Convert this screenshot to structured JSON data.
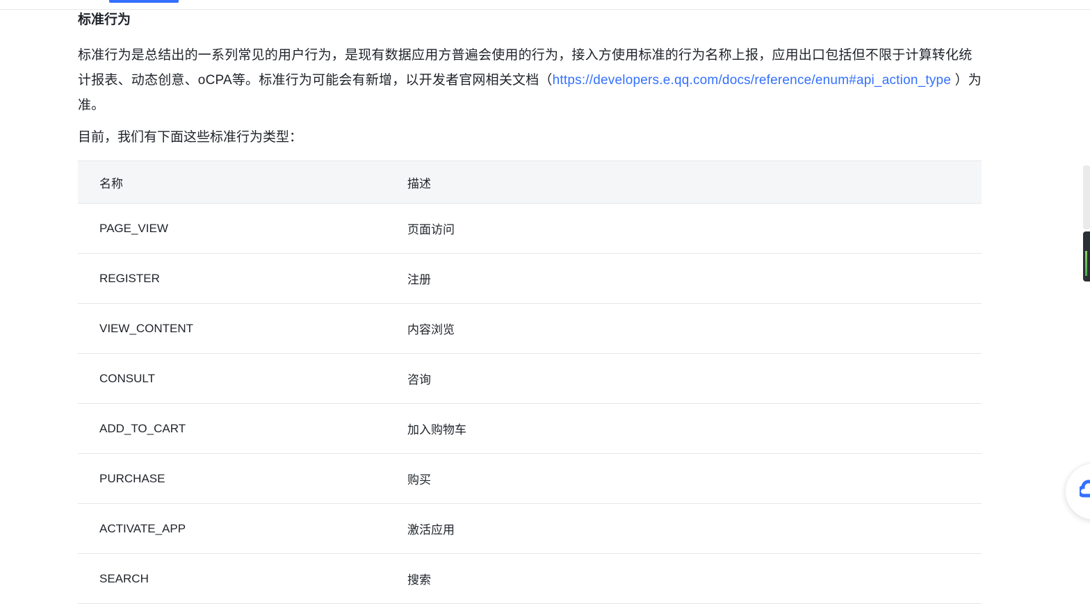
{
  "section": {
    "title": "标准行为",
    "intro_text": "标准行为是总结出的一系列常见的用户行为，是现有数据应用方普遍会使用的行为，接入方使用标准的行为名称上报，应用出口包括但不限于计算转化统计报表、动态创意、oCPA等。标准行为可能会有新增，以开发者官网相关文档（",
    "link_text": "https://developers.e.qq.com/docs/reference/enum#api_action_type",
    "intro_suffix": " ）为准。",
    "types_intro": "目前，我们有下面这些标准行为类型："
  },
  "table": {
    "headers": {
      "name": "名称",
      "description": "描述"
    },
    "rows": [
      {
        "name": "PAGE_VIEW",
        "description": "页面访问"
      },
      {
        "name": "REGISTER",
        "description": "注册"
      },
      {
        "name": "VIEW_CONTENT",
        "description": "内容浏览"
      },
      {
        "name": "CONSULT",
        "description": "咨询"
      },
      {
        "name": "ADD_TO_CART",
        "description": "加入购物车"
      },
      {
        "name": "PURCHASE",
        "description": "购买"
      },
      {
        "name": "ACTIVATE_APP",
        "description": "激活应用"
      },
      {
        "name": "SEARCH",
        "description": "搜索"
      }
    ]
  },
  "colors": {
    "link": "#3370ff",
    "text": "#1f2329",
    "header_bg": "#f5f6f7",
    "border": "#e5e6eb"
  },
  "icons": {
    "float_button": "cloud-service-icon"
  }
}
